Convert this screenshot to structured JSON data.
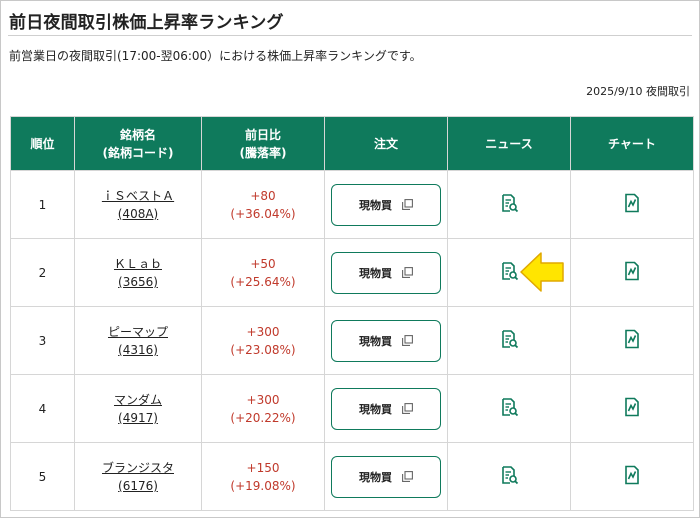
{
  "page": {
    "title": "前日夜間取引株価上昇率ランキング",
    "description": "前営業日の夜間取引(17:00-翌06:00）における株価上昇率ランキングです。",
    "date": "2025/9/10 夜間取引"
  },
  "table": {
    "headers": {
      "rank": "順位",
      "name_line1": "銘柄名",
      "name_line2": "(銘柄コード)",
      "change_line1": "前日比",
      "change_line2": "(騰落率)",
      "order": "注文",
      "news": "ニュース",
      "chart": "チャート"
    },
    "rows": [
      {
        "rank": "1",
        "name": "ｉＳベストＡ",
        "code": "(408A)",
        "change": "+80",
        "change_pct": "(+36.04%)",
        "order_label": "現物買"
      },
      {
        "rank": "2",
        "name": "ＫＬａｂ",
        "code": "(3656)",
        "change": "+50",
        "change_pct": "(+25.64%)",
        "order_label": "現物買"
      },
      {
        "rank": "3",
        "name": "ピーマップ",
        "code": "(4316)",
        "change": "+300",
        "change_pct": "(+23.08%)",
        "order_label": "現物買"
      },
      {
        "rank": "4",
        "name": "マンダム",
        "code": "(4917)",
        "change": "+300",
        "change_pct": "(+20.22%)",
        "order_label": "現物買"
      },
      {
        "rank": "5",
        "name": "ブランジスタ",
        "code": "(6176)",
        "change": "+150",
        "change_pct": "(+19.08%)",
        "order_label": "現物買"
      }
    ]
  },
  "icons": {
    "news": "news-search-icon",
    "chart": "chart-document-icon",
    "order": "copy-icon",
    "pointer": "yellow-arrow-icon"
  },
  "colors": {
    "header_bg": "#0f7a5c",
    "accent": "#0f7a5c",
    "change_up": "#c0392b",
    "arrow": "#ffe500"
  }
}
